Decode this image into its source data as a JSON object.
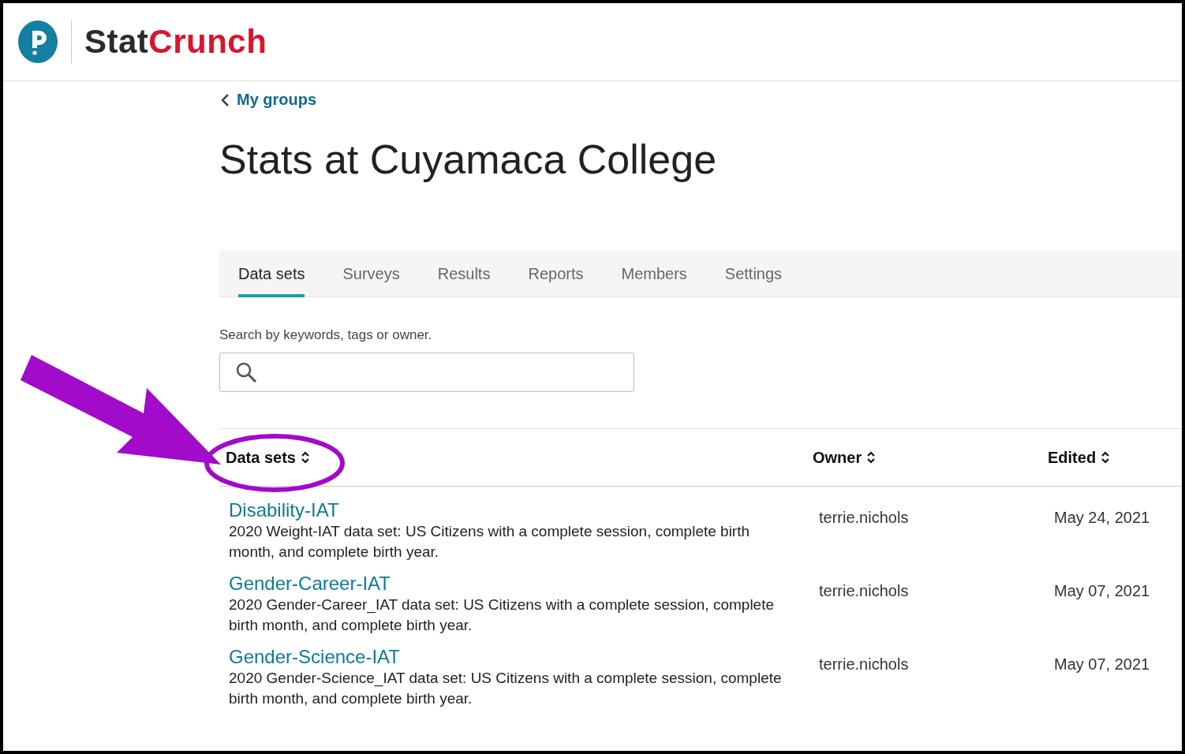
{
  "brand": {
    "name_first": "Stat",
    "name_second": "Crunch"
  },
  "back_link": {
    "label": "My groups"
  },
  "page_title": "Stats at Cuyamaca College",
  "tabs": [
    {
      "label": "Data sets",
      "selected": true
    },
    {
      "label": "Surveys",
      "selected": false
    },
    {
      "label": "Results",
      "selected": false
    },
    {
      "label": "Reports",
      "selected": false
    },
    {
      "label": "Members",
      "selected": false
    },
    {
      "label": "Settings",
      "selected": false
    }
  ],
  "search": {
    "label": "Search by keywords, tags or owner."
  },
  "table": {
    "columns": [
      "Data sets",
      "Owner",
      "Edited"
    ],
    "rows": [
      {
        "title": "Disability-IAT",
        "description": "2020 Weight-IAT data set: US Citizens with a complete session, complete birth month, and complete birth year.",
        "owner": "terrie.nichols",
        "edited": "May 24, 2021"
      },
      {
        "title": "Gender-Career-IAT",
        "description": "2020 Gender-Career_IAT data set: US Citizens with a complete session, complete birth month, and complete birth year.",
        "owner": "terrie.nichols",
        "edited": "May 07, 2021"
      },
      {
        "title": "Gender-Science-IAT",
        "description": "2020 Gender-Science_IAT data set: US Citizens with a complete session, complete birth month, and complete birth year.",
        "owner": "terrie.nichols",
        "edited": "May 07, 2021"
      }
    ]
  }
}
